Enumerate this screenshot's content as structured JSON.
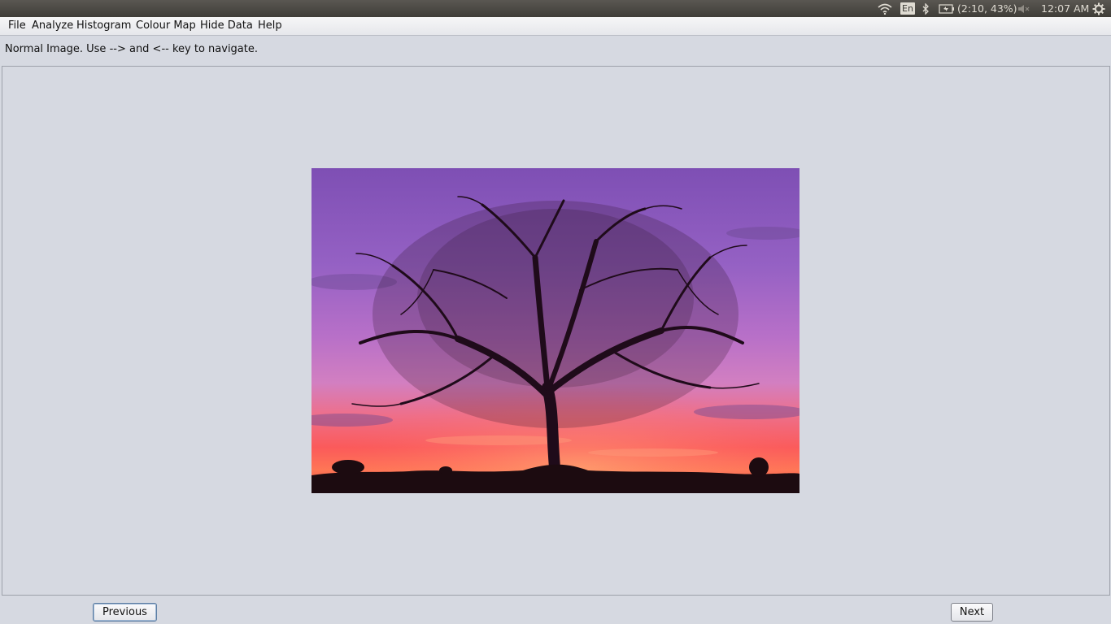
{
  "top_panel": {
    "language": "En",
    "battery": "(2:10, 43%)",
    "clock": "12:07 AM",
    "icons": [
      "wifi-icon",
      "bluetooth-icon",
      "battery-icon",
      "volume-muted-icon",
      "settings-gear-icon"
    ]
  },
  "menu": {
    "items": [
      "File",
      "Analyze",
      "Histogram",
      "Colour Map",
      "Hide Data",
      "Help"
    ]
  },
  "status": {
    "text": "Normal Image. Use --> and <-- key to navigate."
  },
  "image": {
    "description_icon": "tree-sunset-photo"
  },
  "buttons": {
    "previous": "Previous",
    "next": "Next"
  }
}
